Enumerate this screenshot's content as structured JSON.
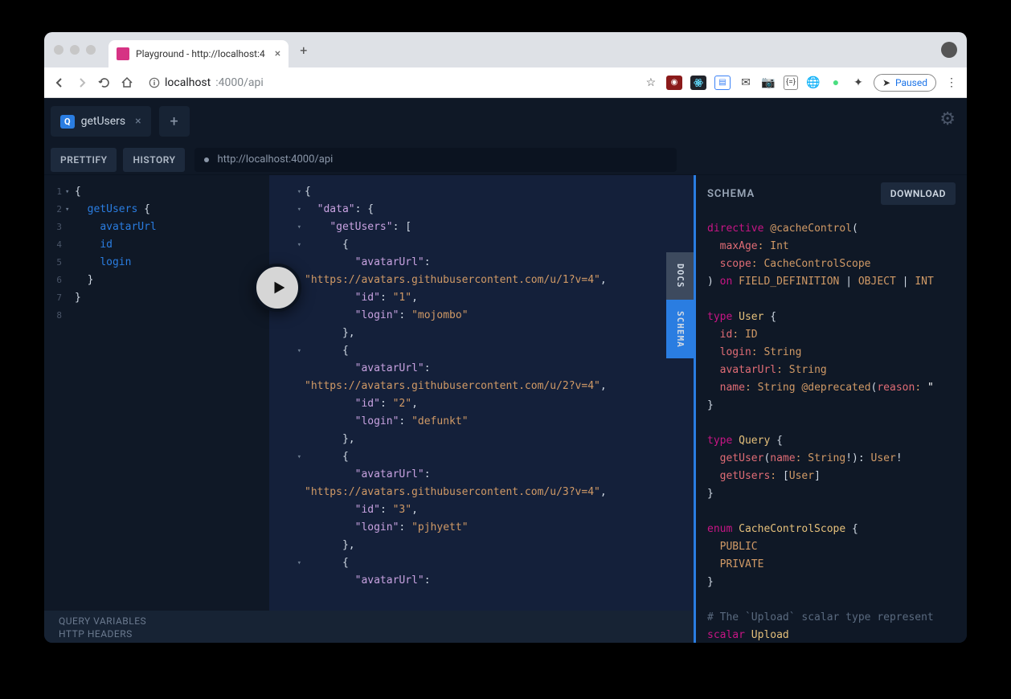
{
  "browser": {
    "tab_title": "Playground - http://localhost:4",
    "url_host": "localhost",
    "url_path": ":4000/api",
    "paused_label": "Paused"
  },
  "app": {
    "tab_label": "getUsers",
    "prettify": "PRETTIFY",
    "history": "HISTORY",
    "endpoint": "http://localhost:4000/api",
    "query_vars": "QUERY VARIABLES",
    "http_headers": "HTTP HEADERS",
    "docs_tab": "DOCS",
    "schema_tab": "SCHEMA",
    "schema_title": "SCHEMA",
    "download": "DOWNLOAD"
  },
  "query": {
    "lines": [
      {
        "n": "1",
        "fold": "▾",
        "code_html": "<span class='k-br'>{</span>"
      },
      {
        "n": "2",
        "fold": "▾",
        "code_html": "  <span class='k-field'>getUsers</span> <span class='k-br'>{</span>"
      },
      {
        "n": "3",
        "fold": "",
        "code_html": "    <span class='k-field'>avatarUrl</span>"
      },
      {
        "n": "4",
        "fold": "",
        "code_html": "    <span class='k-field'>id</span>"
      },
      {
        "n": "5",
        "fold": "",
        "code_html": "    <span class='k-field'>login</span>"
      },
      {
        "n": "6",
        "fold": "",
        "code_html": "  <span class='k-br'>}</span>"
      },
      {
        "n": "7",
        "fold": "",
        "code_html": "<span class='k-br'>}</span>"
      },
      {
        "n": "8",
        "fold": "",
        "code_html": ""
      }
    ]
  },
  "result": {
    "lines": [
      {
        "fold": "▾",
        "html": "<span class='j-punc'>{</span>"
      },
      {
        "fold": "▾",
        "html": "  <span class='j-key'>\"data\"</span><span class='j-punc'>: {</span>"
      },
      {
        "fold": "▾",
        "html": "    <span class='j-key'>\"getUsers\"</span><span class='j-punc'>: [</span>"
      },
      {
        "fold": "▾",
        "html": "      <span class='j-punc'>{</span>"
      },
      {
        "fold": "",
        "html": "        <span class='j-key'>\"avatarUrl\"</span><span class='j-punc'>:</span>"
      },
      {
        "fold": "",
        "html": "<span class='j-str'>\"https://avatars.githubusercontent.com/u/1?v=4\"</span><span class='j-punc'>,</span>"
      },
      {
        "fold": "",
        "html": "        <span class='j-key'>\"id\"</span><span class='j-punc'>: </span><span class='j-str'>\"1\"</span><span class='j-punc'>,</span>"
      },
      {
        "fold": "",
        "html": "        <span class='j-key'>\"login\"</span><span class='j-punc'>: </span><span class='j-str'>\"mojombo\"</span>"
      },
      {
        "fold": "",
        "html": "      <span class='j-punc'>},</span>"
      },
      {
        "fold": "▾",
        "html": "      <span class='j-punc'>{</span>"
      },
      {
        "fold": "",
        "html": "        <span class='j-key'>\"avatarUrl\"</span><span class='j-punc'>:</span>"
      },
      {
        "fold": "",
        "html": "<span class='j-str'>\"https://avatars.githubusercontent.com/u/2?v=4\"</span><span class='j-punc'>,</span>"
      },
      {
        "fold": "",
        "html": "        <span class='j-key'>\"id\"</span><span class='j-punc'>: </span><span class='j-str'>\"2\"</span><span class='j-punc'>,</span>"
      },
      {
        "fold": "",
        "html": "        <span class='j-key'>\"login\"</span><span class='j-punc'>: </span><span class='j-str'>\"defunkt\"</span>"
      },
      {
        "fold": "",
        "html": "      <span class='j-punc'>},</span>"
      },
      {
        "fold": "▾",
        "html": "      <span class='j-punc'>{</span>"
      },
      {
        "fold": "",
        "html": "        <span class='j-key'>\"avatarUrl\"</span><span class='j-punc'>:</span>"
      },
      {
        "fold": "",
        "html": "<span class='j-str'>\"https://avatars.githubusercontent.com/u/3?v=4\"</span><span class='j-punc'>,</span>"
      },
      {
        "fold": "",
        "html": "        <span class='j-key'>\"id\"</span><span class='j-punc'>: </span><span class='j-str'>\"3\"</span><span class='j-punc'>,</span>"
      },
      {
        "fold": "",
        "html": "        <span class='j-key'>\"login\"</span><span class='j-punc'>: </span><span class='j-str'>\"pjhyett\"</span>"
      },
      {
        "fold": "",
        "html": "      <span class='j-punc'>},</span>"
      },
      {
        "fold": "▾",
        "html": "      <span class='j-punc'>{</span>"
      },
      {
        "fold": "",
        "html": "        <span class='j-key'>\"avatarUrl\"</span><span class='j-punc'>:</span>"
      }
    ]
  },
  "schema": {
    "lines": [
      "<span class='s-kw'>directive</span> <span class='s-dir'>@cacheControl</span><span class='s-white'>(</span>",
      "  <span class='s-arg'>maxAge</span><span class='s-punc'>:</span> <span class='s-type'>Int</span>",
      "  <span class='s-arg'>scope</span><span class='s-punc'>:</span> <span class='s-type'>CacheControlScope</span>",
      "<span class='s-white'>)</span> <span class='s-kw'>on</span> <span class='s-type'>FIELD_DEFINITION</span> <span class='s-white'>|</span> <span class='s-type'>OBJECT</span> <span class='s-white'>|</span> <span class='s-type'>INT</span>",
      "",
      "<span class='s-kw'>type</span> <span class='s-name'>User</span> <span class='s-white'>{</span>",
      "  <span class='s-arg'>id</span><span class='s-punc'>:</span> <span class='s-type'>ID</span>",
      "  <span class='s-arg'>login</span><span class='s-punc'>:</span> <span class='s-type'>String</span>",
      "  <span class='s-arg'>avatarUrl</span><span class='s-punc'>:</span> <span class='s-type'>String</span>",
      "  <span class='s-arg'>name</span><span class='s-punc'>:</span> <span class='s-type'>String</span> <span class='s-dir'>@deprecated</span><span class='s-white'>(</span><span class='s-arg'>reason</span><span class='s-punc'>:</span> <span class='s-qstr'>\"</span>",
      "<span class='s-white'>}</span>",
      "",
      "<span class='s-kw'>type</span> <span class='s-name'>Query</span> <span class='s-white'>{</span>",
      "  <span class='s-arg'>getUser</span><span class='s-white'>(</span><span class='s-arg'>name</span><span class='s-punc'>:</span> <span class='s-type'>String</span><span class='s-white'>!):</span> <span class='s-type'>User</span><span class='s-white'>!</span>",
      "  <span class='s-arg'>getUsers</span><span class='s-punc'>:</span> <span class='s-white'>[</span><span class='s-type'>User</span><span class='s-white'>]</span>",
      "<span class='s-white'>}</span>",
      "",
      "<span class='s-kw'>enum</span> <span class='s-name'>CacheControlScope</span> <span class='s-white'>{</span>",
      "  <span class='s-type'>PUBLIC</span>",
      "  <span class='s-type'>PRIVATE</span>",
      "<span class='s-white'>}</span>",
      "",
      "<span class='s-comment'># The `Upload` scalar type represent</span>",
      "<span class='s-kw'>scalar</span> <span class='s-name'>Upload</span>"
    ]
  }
}
